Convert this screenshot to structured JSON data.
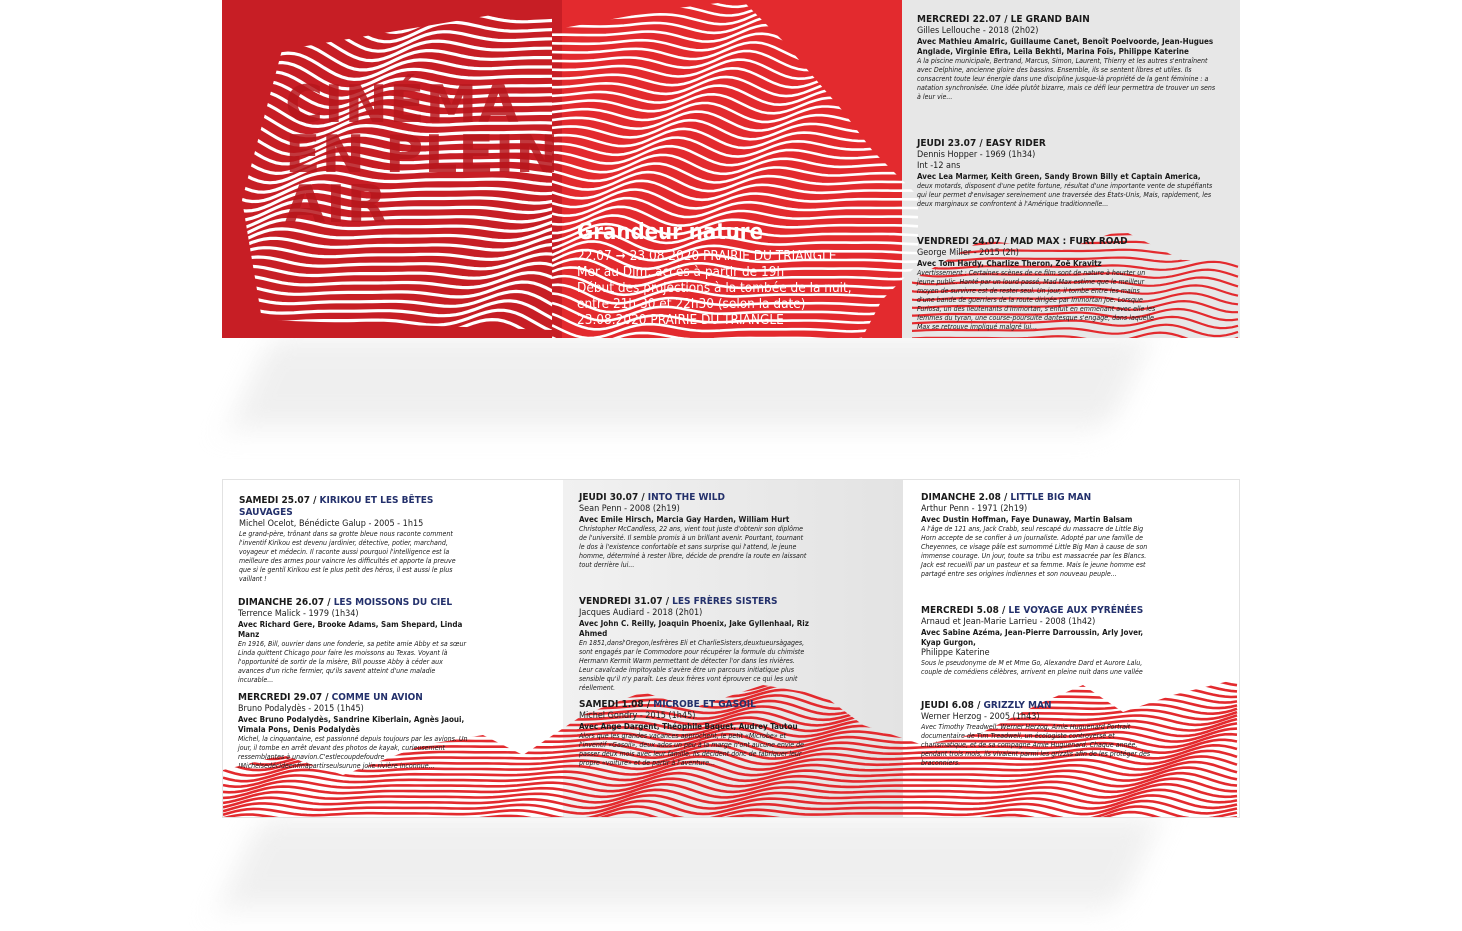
{
  "cover": {
    "title_lines": [
      "CINÉMA",
      "EN PLEIN",
      "AIR"
    ],
    "headline": "Grandeur nature",
    "dates_start": "22.07",
    "dates_arrow": "➞",
    "dates_end": "23.08.2020 PRAIRIE DU TRIANGLE",
    "info_1": "Mer au Dim, accès à partir de 19h",
    "info_2": "Début des projections à la tombée de la nuit,",
    "info_3": "entre 21h 30 et 22h30 (selon la date)",
    "info_4": "23.08.2020 PRAIRIE DU TRIANGLE"
  },
  "colors": {
    "red_dark": "#c71e25",
    "red": "#e32a2e",
    "grey": "#e7e7e7",
    "navy": "#23306b"
  },
  "top_programme": [
    {
      "day": "MERCREDI 22.07 / ",
      "film": "LE GRAND BAIN",
      "director": "Gilles Lellouche - 2018 (2h02)",
      "cast": "Avec Mathieu Amalric, Guillaume Canet, Benoît Poelvoorde, Jean-Hugues Anglade, Virginie Efira, Leïla Bekhti, Marina Foïs, Philippe Katerine",
      "synopsis": "A la piscine municipale, Bertrand, Marcus, Simon, Laurent, Thierry et les autres s'entraînent avec Delphine, ancienne gloire des bassins. Ensemble, ils se sentent libres et utiles. Ils consacrent toute leur énergie dans une discipline jusque-là propriété de la gent féminine : a natation synchronisée. Une idée plutôt bizarre, mais ce défi leur permettra de trouver un sens à leur vie..."
    },
    {
      "day": "JEUDI 23.07 / ",
      "film": "EASY RIDER",
      "director": "Dennis Hopper - 1969 (1h34)",
      "note": "Int -12 ans",
      "cast": "Avec Lea Marmer, Keith Green, Sandy Brown Billy et Captain America,",
      "synopsis": "deux motards, disposent d'une petite fortune, résultat d'une importante vente de stupéfiants qui leur permet d'envisager sereinement une traversée des États-Unis, Mais, rapidement, les deux marginaux se confrontent à l'Amérique traditionnelle..."
    },
    {
      "day": "VENDREDI 24.07 / ",
      "film": "MAD MAX : FURY ROAD",
      "director": "George Miller - 2015 (2h)",
      "cast": "Avec Tom Hardy, Charlize Theron, Zoë Kravitz",
      "synopsis": "Avertissement : Certaines scènes de ce film sont de nature à heurter un jeune public. Hanté par un lourd passé, Mad Max estime que le meilleur moyen de survivre est de rester seul. Un jour, il tombe entre les mains d'une bande de guerriers de la route dirigée par Immortan Joe. Lorsque Furiosa, un des lieutenants d'Immortan, s'enfuit en emmenant avec elle les femmes du tyran, une course-poursuite dantesque s'engage, dans laquelle Max se retrouve impliqué malgré lui..."
    }
  ],
  "bottom_programme": [
    {
      "day": "SAMEDI 25.07 / ",
      "film": "KIRIKOU ET LES BÊTES SAUVAGES",
      "director": "Michel Ocelot, Bénédicte Galup - 2005 - 1h15",
      "cast": "",
      "synopsis": "Le grand-père, trônant dans sa grotte bleue nous raconte comment l'inventif Kirikou est devenu jardinier, détective, potier, marchand, voyageur et médecin. Il raconte aussi pourquoi l'intelligence est la meilleure des armes pour vaincre les difficultés et apporte la preuve que si le gentil Kirikou est le plus petit des héros, il est aussi le plus vaillant !"
    },
    {
      "day": "DIMANCHE 26.07 / ",
      "film": "LES MOISSONS DU CIEL",
      "director": "Terrence Malick - 1979 (1h34)",
      "cast": "Avec Richard Gere, Brooke Adams, Sam Shepard, Linda Manz",
      "synopsis": "En 1916, Bill, ouvrier dans une fonderie, sa petite amie Abby et sa sœur Linda quittent Chicago pour faire les moissons au Texas. Voyant là l'opportunité de sortir de la misère, Bill pousse Abby à céder aux avances d'un riche fermier, qu'ils savent atteint d'une maladie incurable..."
    },
    {
      "day": "MERCREDI 29.07 / ",
      "film": "COMME UN AVION",
      "director": "Bruno Podalydès - 2015 (1h45)",
      "cast": "Avec Bruno Podalydès, Sandrine Kiberlain, Agnès Jaoui, Vimala Pons, Denis Podalydès",
      "synopsis": "Michel, la cinquantaine, est passionné depuis toujours par les avions. Un jour, il tombe en arrêt devant des photos de kayak, curieusement ressemblantes à unavion.C'estlecoupdefoudre !Michelsedécideenfinàpartirseulsurune jolie rivière inconnue..."
    },
    {
      "day": "JEUDI 30.07 / ",
      "film": "INTO THE WILD",
      "director": "Sean Penn - 2008 (2h19)",
      "cast": "Avec Emile Hirsch, Marcia Gay Harden, William Hurt",
      "synopsis": "Christopher McCandless, 22 ans, vient tout juste d'obtenir son diplôme de l'université. Il semble promis à un brillant avenir. Pourtant, tournant le dos à l'existence confortable et sans surprise qui l'attend, le jeune homme, déterminé à rester libre, décide de prendre la route en laissant tout derrière lui..."
    },
    {
      "day": "VENDREDI 31.07 / ",
      "film": "LES FRÈRES SISTERS",
      "director": "Jacques Audiard - 2018 (2h01)",
      "cast": "Avec John C. Reilly, Joaquin Phoenix, Jake Gyllenhaal, Riz Ahmed",
      "synopsis": "En 1851,dansl'Oregon,lesfrères Eli et CharlieSisters,deuxtueursàgages, sont engagés par le Commodore pour récupérer la formule du chimiste Hermann Kermit Warm permettant de détecter l'or dans les rivières. Leur cavalcade impitoyable s'avère être un parcours initiatique plus sensible qu'il n'y paraît. Les deux frères vont éprouver ce qui les unit réellement."
    },
    {
      "day": "SAMEDI 1.08 / ",
      "film": "MICROBE ET GASOIL",
      "director": "Michel Gondry - 2015 (1h45)",
      "cast": "Avec Ange Dargent, Théophile Baquet, Audrey Tautou",
      "synopsis": "Alors que les grandes vacances approchent, le petit «Microbe» et l'inventif «Gasoil», deux ados un peu à la marge n'ont aucune envie de passer deux mois avec leur famille. Ils décident donc de fabriquer leur propre «voiture» et de partir à l'aventure..."
    },
    {
      "day": "DIMANCHE 2.08 / ",
      "film": "LITTLE BIG MAN",
      "director": "Arthur Penn - 1971 (2h19)",
      "cast": "Avec Dustin Hoffman, Faye Dunaway, Martin Balsam",
      "synopsis": "A l'âge de 121 ans, Jack Crabb, seul rescapé du massacre de Little Big Horn accepte de se confier à un journaliste. Adopté par une famille de Cheyennes, ce visage pâle est surnommé Little Big Man à cause de son immense courage. Un jour, toute sa tribu est massacrée par les Blancs. Jack est recueilli par un pasteur et sa femme. Mais le jeune homme est partagé entre ses origines indiennes et son nouveau peuple..."
    },
    {
      "day": "MERCREDI 5.08 / ",
      "film": "LE VOYAGE AUX PYRÉNÉES",
      "director": "Arnaud et Jean-Marie Larrieu - 2008 (1h42)",
      "cast": "Avec Sabine Azéma, Jean-Pierre Darroussin, Arly Jover, Kyap Gurgon,",
      "note": "Philippe Katerine",
      "synopsis": "Sous le pseudonyme de M et Mme Go, Alexandre Dard et Aurore Lalu, couple de comédiens célèbres, arrivent en pleine nuit dans une vallée"
    },
    {
      "day": "JEUDI 6.08 / ",
      "film": "GRIZZLY MAN",
      "director": "Werner Herzog - 2005 (1h43)",
      "cast": "",
      "synopsis": "Avec Timothy Treadwell, Werner Herzog, Amie Huguenard Portrait documentaire de Tim Treadwell, un écologiste controversé et charismatique, et de sa compagne Amie Huguenard. Chaque année, pendant trois mois, ils vivaient parmi les grizzlis afin de les protéger des braconniers."
    }
  ]
}
